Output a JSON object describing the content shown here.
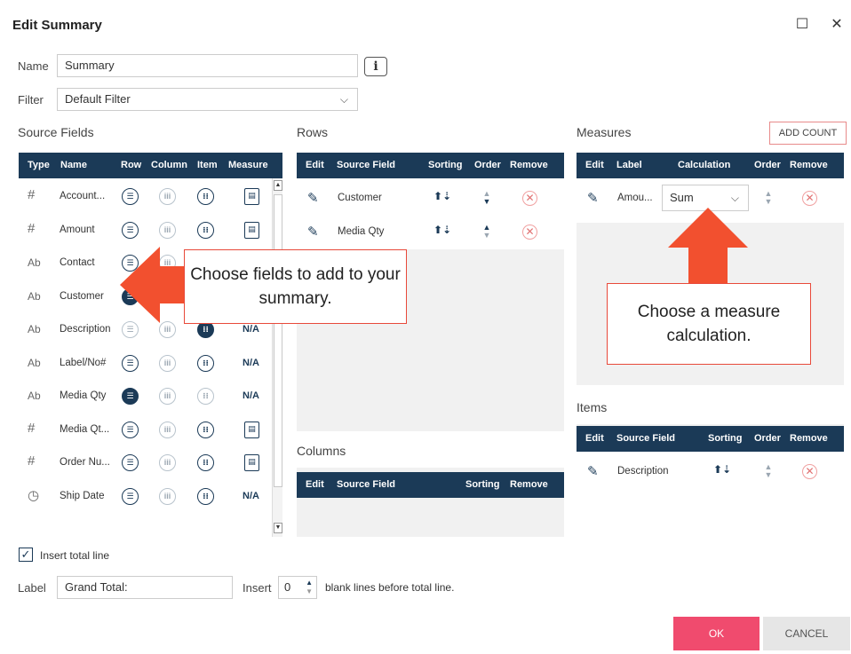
{
  "dialog": {
    "title": "Edit Summary",
    "maximize_glyph": "☐",
    "close_glyph": "✕"
  },
  "name_field": {
    "label": "Name",
    "value": "Summary",
    "info_glyph": "i"
  },
  "filter_field": {
    "label": "Filter",
    "value": "Default Filter"
  },
  "source_fields": {
    "title": "Source Fields",
    "headers": [
      "Type",
      "Name",
      "Row",
      "Column",
      "Item",
      "Measure"
    ],
    "rows": [
      {
        "type": "#",
        "name": "Account...",
        "row": "normal",
        "column": "light",
        "item": "normal",
        "measure": "calc"
      },
      {
        "type": "#",
        "name": "Amount",
        "row": "normal",
        "column": "light",
        "item": "normal",
        "measure": "calc"
      },
      {
        "type": "Ab",
        "name": "Contact",
        "row": "normal",
        "column": "light",
        "item": "",
        "measure": ""
      },
      {
        "type": "Ab",
        "name": "Customer",
        "row": "filled",
        "column": "",
        "item": "",
        "measure": ""
      },
      {
        "type": "Ab",
        "name": "Description",
        "row": "light",
        "column": "light",
        "item": "filled",
        "measure": "N/A"
      },
      {
        "type": "Ab",
        "name": "Label/No#",
        "row": "normal",
        "column": "light",
        "item": "normal",
        "measure": "N/A"
      },
      {
        "type": "Ab",
        "name": "Media Qty",
        "row": "filled",
        "column": "light",
        "item": "light",
        "measure": "N/A"
      },
      {
        "type": "#",
        "name": "Media Qt...",
        "row": "normal",
        "column": "light",
        "item": "normal",
        "measure": "calc"
      },
      {
        "type": "#",
        "name": "Order Nu...",
        "row": "normal",
        "column": "light",
        "item": "normal",
        "measure": "calc"
      },
      {
        "type": "clock",
        "name": "Ship Date",
        "row": "normal",
        "column": "light",
        "item": "normal",
        "measure": "N/A"
      }
    ]
  },
  "rows_panel": {
    "title": "Rows",
    "headers": [
      "Edit",
      "Source Field",
      "Sorting",
      "Order",
      "Remove"
    ],
    "rows": [
      {
        "field": "Customer"
      },
      {
        "field": "Media Qty"
      }
    ]
  },
  "columns_panel": {
    "title": "Columns",
    "headers": [
      "Edit",
      "Source Field",
      "Sorting",
      "Remove"
    ]
  },
  "measures_panel": {
    "title": "Measures",
    "add_count": "ADD COUNT",
    "headers": [
      "Edit",
      "Label",
      "Calculation",
      "Order",
      "Remove"
    ],
    "rows": [
      {
        "label": "Amou...",
        "calculation": "Sum"
      }
    ]
  },
  "items_panel": {
    "title": "Items",
    "headers": [
      "Edit",
      "Source Field",
      "Sorting",
      "Order",
      "Remove"
    ],
    "rows": [
      {
        "field": "Description"
      }
    ]
  },
  "callouts": {
    "left": "Choose fields to add to your summary.",
    "right": "Choose a measure calculation."
  },
  "total": {
    "checkbox_label": "Insert total line",
    "label_label": "Label",
    "label_value": "Grand Total:",
    "insert_label": "Insert",
    "blank_lines": "0",
    "suffix": "blank lines before total line."
  },
  "buttons": {
    "ok": "OK",
    "cancel": "CANCEL"
  },
  "colors": {
    "header": "#1b3a57",
    "ok": "#f04b6e",
    "arrow": "#f2502f"
  }
}
